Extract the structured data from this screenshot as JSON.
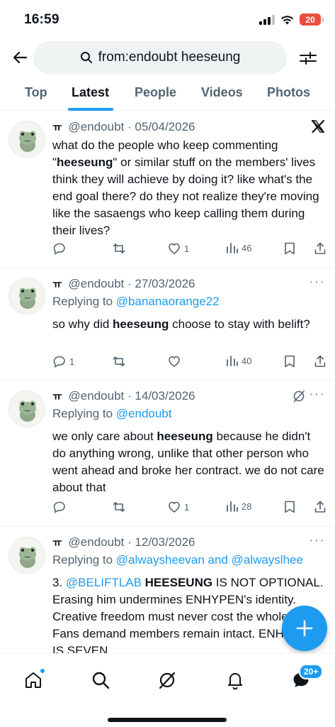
{
  "status_bar": {
    "time": "16:59",
    "battery": "20"
  },
  "search": {
    "query": "from:endoubt heeseung"
  },
  "tabs": [
    {
      "label": "Top"
    },
    {
      "label": "Latest"
    },
    {
      "label": "People"
    },
    {
      "label": "Videos"
    },
    {
      "label": "Photos"
    }
  ],
  "tweets": [
    {
      "name": "ㅠ",
      "handle": "@endoubt",
      "sep": "·",
      "date": "05/04/2026",
      "text_parts": [
        "what do the people who keep commenting \"",
        "heeseung",
        "\" or similar stuff on the members' lives think they will achieve by doing it? like what's the end goal there? do they not realize they're moving like the sasaengs who keep calling them during their lives?"
      ],
      "replies": "",
      "retweets": "",
      "likes": "1",
      "views": "46"
    },
    {
      "name": "ㅠ",
      "handle": "@endoubt",
      "sep": "·",
      "date": "27/03/2026",
      "replying_prefix": "Replying to ",
      "replying_to": "@bananaorange22",
      "text_parts": [
        "so why did ",
        "heeseung",
        " choose to stay with belift?"
      ],
      "replies": "1",
      "retweets": "",
      "likes": "",
      "views": "40"
    },
    {
      "name": "ㅠ",
      "handle": "@endoubt",
      "sep": "·",
      "date": "14/03/2026",
      "replying_prefix": "Replying to ",
      "replying_to": "@endoubt",
      "text_parts": [
        "we only care about ",
        "heeseung",
        " because he didn't do anything wrong, unlike that other person who went ahead and broke her contract. we do not care about that"
      ],
      "replies": "",
      "retweets": "",
      "likes": "1",
      "views": "28"
    },
    {
      "name": "ㅠ",
      "handle": "@endoubt",
      "sep": "·",
      "date": "12/03/2026",
      "replying_prefix": "Replying to ",
      "replying_to": "@alwaysheevan and @alwayslhee",
      "text_parts": [
        "3. ",
        "@BELIFTLAB",
        " ",
        "HEESEUNG",
        " IS NOT OPTIONAL. Erasing him undermines ENHYPEN's identity. Creative freedom must never cost the whole team. Fans demand members remain intact. ENHYPEN IS SEVEN"
      ]
    }
  ],
  "more_label": "···",
  "nav": {
    "messages_badge": "20+"
  },
  "colors": {
    "accent": "#1d9bf0",
    "text": "#0f1419",
    "muted": "#536471",
    "battery": "#eb4d3d"
  }
}
